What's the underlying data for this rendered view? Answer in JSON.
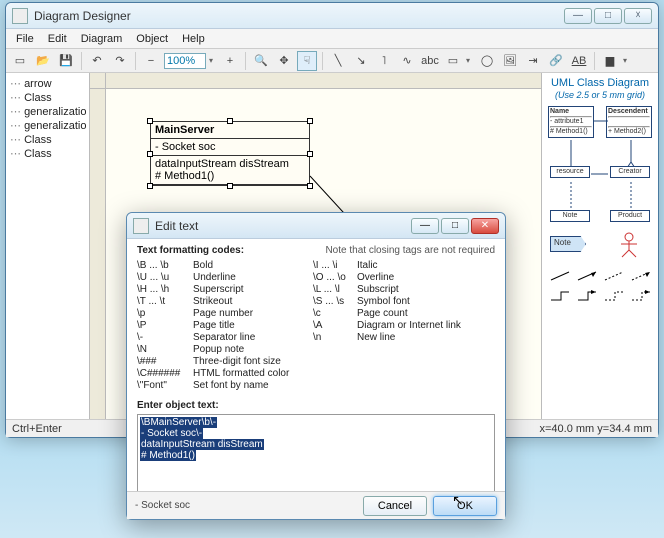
{
  "app": {
    "title": "Diagram Designer"
  },
  "window_buttons": {
    "minimize": "—",
    "maximize": "□",
    "close": "☓"
  },
  "menu": [
    "File",
    "Edit",
    "Diagram",
    "Object",
    "Help"
  ],
  "toolbar": {
    "zoom": "100%",
    "textbtn": "abc",
    "ab_under": "AB"
  },
  "tree": [
    "arrow",
    "Class",
    "generalization",
    "generalization",
    "Class",
    "Class"
  ],
  "uml": {
    "title": "MainServer",
    "attrs": "- Socket soc",
    "ops1": "dataInputStream disStream",
    "ops2": "# Method1()"
  },
  "palette": {
    "title": "UML Class Diagram",
    "subtitle": "(Use 2.5 or 5 mm grid)",
    "box_name_hdr": "Name",
    "box_name_a": "- attribute1",
    "box_name_m": "# Method1()",
    "box_desc_hdr": "Descendent",
    "box_desc_m": "+ Method2()",
    "lbl_resource": "resource",
    "lbl_creator": "Creator",
    "lbl_note": "Note",
    "lbl_product": "Product",
    "tag_note": "Note"
  },
  "status": {
    "left": "Ctrl+Enter",
    "coords": "x=40.0 mm  y=34.4 mm"
  },
  "dialog": {
    "title": "Edit text",
    "heading": "Text formatting codes:",
    "note": "Note that closing tags are not required",
    "codes": [
      [
        "\\B ... \\b",
        "Bold",
        "\\I ... \\i",
        "Italic"
      ],
      [
        "\\U ... \\u",
        "Underline",
        "\\O ... \\o",
        "Overline"
      ],
      [
        "\\H ... \\h",
        "Superscript",
        "\\L ... \\l",
        "Subscript"
      ],
      [
        "\\T ... \\t",
        "Strikeout",
        "\\S ... \\s",
        "Symbol font"
      ],
      [
        "\\p",
        "Page number",
        "\\c",
        "Page count"
      ],
      [
        "\\P",
        "Page title",
        "\\A",
        "Diagram or Internet link"
      ],
      [
        "\\-",
        "Separator line",
        "\\n",
        "New line"
      ],
      [
        "\\N",
        "Popup note",
        "",
        ""
      ],
      [
        "\\###",
        "Three-digit font size",
        "",
        ""
      ],
      [
        "\\C######",
        "HTML formatted color",
        "",
        ""
      ],
      [
        "\\\"Font\"",
        "Set font by name",
        "",
        ""
      ]
    ],
    "enter_label": "Enter object text:",
    "obj_lines": [
      "\\BMainServer\\b\\-",
      "- Socket soc\\-",
      "dataInputStream disStream",
      "# Method1()"
    ],
    "footer_status": "- Socket soc",
    "btn_cancel": "Cancel",
    "btn_ok": "OK"
  }
}
